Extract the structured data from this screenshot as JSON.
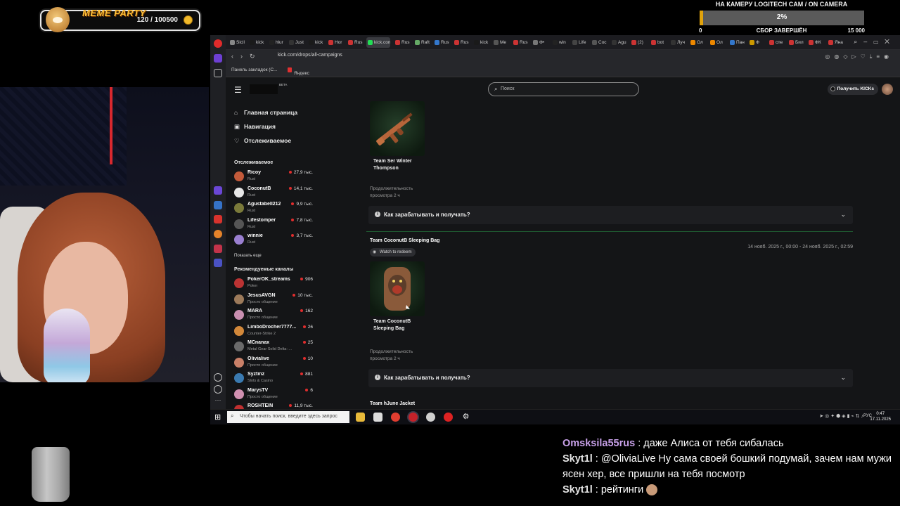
{
  "overlay": {
    "meme_title": "MEME PARTY",
    "meme_count": "120 / 100500",
    "goal_title": "НА КАМЕРУ LOGITECH CAM / ON CAMERA",
    "goal_progress": 0.02,
    "goal_pct": "2%",
    "goal_min": "0",
    "goal_max": "15 000",
    "goal_status": "СБОР ЗАВЕРШЁН"
  },
  "chat": [
    {
      "user": "Omsksila55rus",
      "sep": " : ",
      "text": "даже Алиса от тебя сибалась"
    },
    {
      "user": "Skyt1l",
      "sep": " : ",
      "text": "@OliviaLive Ну сама своей бошкий подумай, зачем нам мужи"
    },
    {
      "user": "",
      "sep": "",
      "text": "ясен хер, все пришли на тебя посмотр"
    },
    {
      "user": "Skyt1l",
      "sep": " : ",
      "text": "рейтинги"
    }
  ],
  "browser": {
    "tabs": [
      "Sicil",
      "kick",
      "hlur",
      "Just",
      "kick",
      "Hor",
      "Rus",
      "kick.com",
      "Rus",
      "Raft",
      "Rust",
      "Rus",
      "kick",
      "Me",
      "Rus",
      "Ф•",
      "win",
      "Life",
      "Coc",
      "Agu",
      "(2)",
      "bot",
      "Луч",
      "Ол",
      "Ол",
      "Пан",
      "Ф",
      "спе",
      "Бил",
      "ФК",
      "Яна"
    ],
    "url": "kick.com/drops/all-campaigns",
    "bookmarks": [
      "Панель закладок (C...",
      "Яндекс"
    ]
  },
  "kick": {
    "beta": "BETA",
    "search_placeholder": "Поиск",
    "get_kicks": "Получить KICKs",
    "nav": [
      {
        "icon": "⌂",
        "label": "Главная страница"
      },
      {
        "icon": "▣",
        "label": "Навигация"
      },
      {
        "icon": "♡",
        "label": "Отслеживаемое"
      }
    ],
    "following_title": "Отслеживаемое",
    "following": [
      {
        "name": "Ricoy",
        "category": "Rust",
        "viewers": "27,9 тыс.",
        "color": "#c25a3a"
      },
      {
        "name": "CoconutB",
        "category": "Rust",
        "viewers": "14,1 тыс.",
        "color": "#e7e7e7"
      },
      {
        "name": "Agustabell212",
        "category": "Rust",
        "viewers": "9,9 тыс.",
        "color": "#7a7a3a"
      },
      {
        "name": "Lifestomper",
        "category": "Rust",
        "viewers": "7,8 тыс.",
        "color": "#555"
      },
      {
        "name": "winnie",
        "category": "Rust",
        "viewers": "3,7 тыс.",
        "color": "#9a7fd0"
      }
    ],
    "show_more": "Показать еще",
    "recommended_title": "Рекомендуемые каналы",
    "recommended": [
      {
        "name": "PokerOK_streams",
        "category": "Poker",
        "viewers": "906",
        "color": "#b33"
      },
      {
        "name": "JesusAVGN",
        "category": "Просто общение",
        "viewers": "10 тыс.",
        "color": "#9c7a5a"
      },
      {
        "name": "MARA",
        "category": "Просто общение",
        "viewers": "162",
        "color": "#c98fb0"
      },
      {
        "name": "LimboDrocher7777...",
        "category": "Counter-Strike 2",
        "viewers": "26",
        "color": "#d2883a"
      },
      {
        "name": "MCnanax",
        "category": "Metal Gear Solid Delta: ...",
        "viewers": "25",
        "color": "#6a6a6a"
      },
      {
        "name": "Olivialive",
        "category": "Просто общение",
        "viewers": "10",
        "color": "#c98068"
      },
      {
        "name": "Syztmz",
        "category": "Slots & Casino",
        "viewers": "881",
        "color": "#3a7ab0"
      },
      {
        "name": "MarysTV",
        "category": "Просто общение",
        "viewers": "6",
        "color": "#d090b0"
      },
      {
        "name": "ROSHTEIN",
        "category": "",
        "viewers": "11,9 тыс.",
        "color": "#c03030"
      }
    ],
    "drops": {
      "item1_name": "Team Ser Winter Thompson",
      "item1_duration": "Продолжительность просмотра 2 ч",
      "howto": "Как зарабатывать и получать?",
      "campaign2_title": "Team CoconutB Sleeping Bag",
      "redeem": "Watch to redeem",
      "campaign2_dates": "14 нояб. 2025 г., 00:00 - 24 нояб. 2025 г., 02:59",
      "item2_name": "Team CoconutB Sleeping Bag",
      "item2_duration": "Продолжительность просмотра 2 ч",
      "campaign3_title": "Team hJune Jacket"
    }
  },
  "taskbar": {
    "search_placeholder": "Чтобы начать поиск, введите здесь запрос",
    "lang": "РУС",
    "time": "0:47",
    "date": "17.11.2025"
  }
}
